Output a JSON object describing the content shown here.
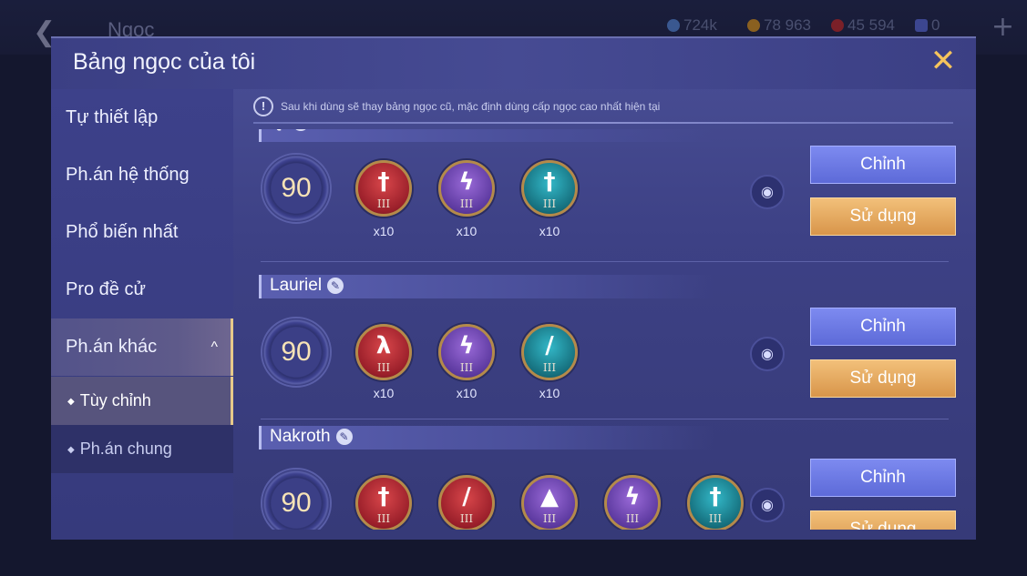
{
  "background": {
    "back_icon": "back-arrow-icon",
    "title": "Ngọc",
    "currencies": [
      {
        "icon": "gem-currency-icon",
        "value": "724k",
        "color": "#4b79c8"
      },
      {
        "icon": "gold-coin-icon",
        "value": "78 963",
        "color": "#c98a2a"
      },
      {
        "icon": "red-token-icon",
        "value": "45 594",
        "color": "#b8343a"
      },
      {
        "icon": "voucher-icon",
        "value": "0",
        "color": "#5a63c0"
      }
    ],
    "plus_label": "+"
  },
  "modal": {
    "title": "Bảng ngọc của tôi",
    "close_label": "✕"
  },
  "sidebar": {
    "items": [
      {
        "label": "Tự thiết lập"
      },
      {
        "label": "Ph.án hệ thống"
      },
      {
        "label": "Phổ biến nhất"
      },
      {
        "label": "Pro đề cử"
      },
      {
        "label": "Ph.án khác",
        "chevron": "^"
      }
    ],
    "subitems": [
      {
        "label": "Tùy chỉnh",
        "selected": true
      },
      {
        "label": "Ph.án chung",
        "selected": false
      }
    ]
  },
  "notice": {
    "icon": "!",
    "text": "Sau khi dùng sẽ thay bảng ngọc cũ, mặc định dùng cấp ngọc cao nhất hiện tại"
  },
  "sets": [
    {
      "name": "Qi",
      "level": "90",
      "gems": [
        {
          "color": "red",
          "icon": "sword-icon",
          "glyph": "†",
          "tier": "III",
          "count": "x10"
        },
        {
          "color": "purple",
          "icon": "lightning-icon",
          "glyph": "ϟ",
          "tier": "III",
          "count": "x10"
        },
        {
          "color": "teal",
          "icon": "dagger-icon",
          "glyph": "†",
          "tier": "III",
          "count": "x10"
        }
      ],
      "edit_label": "Chỉnh",
      "use_label": "Sử dụng"
    },
    {
      "name": "Lauriel",
      "level": "90",
      "gems": [
        {
          "color": "red",
          "icon": "claw-icon",
          "glyph": "λ",
          "tier": "III",
          "count": "x10"
        },
        {
          "color": "purple",
          "icon": "lightning-icon",
          "glyph": "ϟ",
          "tier": "III",
          "count": "x10"
        },
        {
          "color": "teal",
          "icon": "feather-icon",
          "glyph": "/",
          "tier": "III",
          "count": "x10"
        }
      ],
      "edit_label": "Chỉnh",
      "use_label": "Sử dụng"
    },
    {
      "name": "Nakroth",
      "level": "90",
      "gems": [
        {
          "color": "red",
          "icon": "sword-icon",
          "glyph": "†",
          "tier": "III",
          "count": ""
        },
        {
          "color": "red",
          "icon": "blade-icon",
          "glyph": "/",
          "tier": "III",
          "count": ""
        },
        {
          "color": "purple",
          "icon": "drop-icon",
          "glyph": "▲",
          "tier": "III",
          "count": ""
        },
        {
          "color": "purple",
          "icon": "lightning-icon",
          "glyph": "ϟ",
          "tier": "III",
          "count": ""
        },
        {
          "color": "teal",
          "icon": "dagger-icon",
          "glyph": "†",
          "tier": "III",
          "count": ""
        }
      ],
      "edit_label": "Chỉnh",
      "use_label": "Sử dụng"
    }
  ]
}
